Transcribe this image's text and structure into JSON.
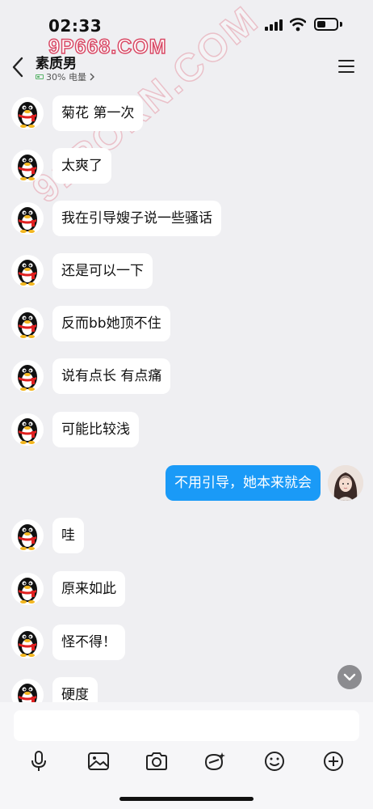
{
  "status": {
    "time": "02:33"
  },
  "watermarks": {
    "top": "9P668.COM",
    "diagonal": "91PORN.COM"
  },
  "header": {
    "contact_name": "素质男",
    "battery_text": "30% 电量"
  },
  "messages": [
    {
      "side": "left",
      "text": "菊花 第一次"
    },
    {
      "side": "left",
      "text": "太爽了"
    },
    {
      "side": "left",
      "text": "我在引导嫂子说一些骚话"
    },
    {
      "side": "left",
      "text": "还是可以一下"
    },
    {
      "side": "left",
      "text": "反而bb她顶不住"
    },
    {
      "side": "left",
      "text": "说有点长 有点痛"
    },
    {
      "side": "left",
      "text": "可能比较浅"
    },
    {
      "side": "right",
      "text": "不用引导，她本来就会"
    },
    {
      "side": "left",
      "text": "哇"
    },
    {
      "side": "left",
      "text": "原来如此"
    },
    {
      "side": "left",
      "text": "怪不得！"
    },
    {
      "side": "left",
      "text": "硬度"
    }
  ],
  "input": {
    "placeholder": ""
  },
  "toolbar": [
    "mic-icon",
    "image-icon",
    "camera-icon",
    "sticker-icon",
    "emoji-icon",
    "plus-icon"
  ],
  "colors": {
    "outgoing_bubble": "#1a9af7",
    "incoming_bubble": "#ffffff",
    "background": "#efeff2"
  }
}
